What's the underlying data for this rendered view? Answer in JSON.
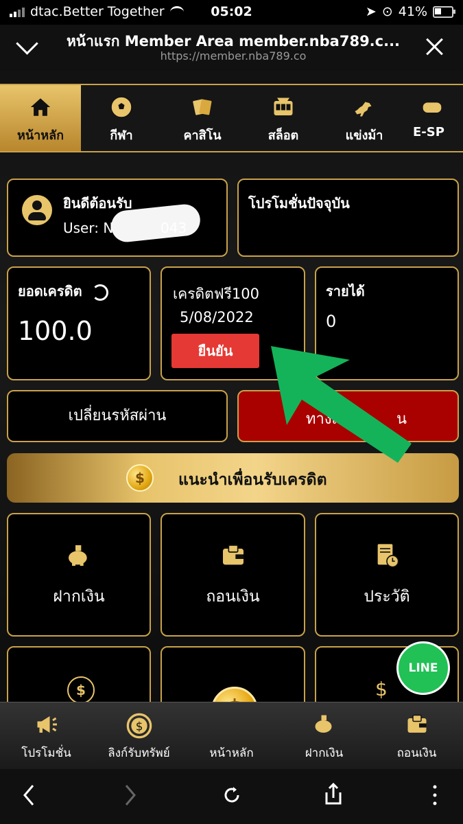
{
  "status_bar": {
    "carrier": "dtac.Better Together",
    "time": "05:02",
    "battery_percent": "41%"
  },
  "browser": {
    "title": "หน้าแรก Member Area member.nba789.c...",
    "url": "https://member.nba789.co"
  },
  "top_nav": {
    "items": [
      {
        "label": "หน้าหลัก",
        "icon": "home-icon",
        "active": true
      },
      {
        "label": "กีฬา",
        "icon": "soccer-ball-icon"
      },
      {
        "label": "คาสิโน",
        "icon": "cards-icon"
      },
      {
        "label": "สล็อต",
        "icon": "slot-machine-icon"
      },
      {
        "label": "แข่งม้า",
        "icon": "horse-racing-icon"
      },
      {
        "label": "E-SP",
        "icon": "gamepad-icon"
      }
    ]
  },
  "welcome": {
    "title": "ยินดีต้อนรับ",
    "user_prefix": "User: N",
    "user_suffix": "043"
  },
  "promo": {
    "title": "โปรโมชั่นปัจจุบัน"
  },
  "credit": {
    "title": "ยอดเครดิต",
    "value": "100.0"
  },
  "free_credit": {
    "title": "เครดิตฟรี100",
    "date": "5/08/2022",
    "confirm_label": "ยืนยัน"
  },
  "income": {
    "title": "รายได้",
    "value": "0"
  },
  "buttons": {
    "change_password": "เปลี่ยนรหัสผ่าน",
    "play_visible_left": "ทางเข",
    "play_visible_right": "น"
  },
  "referral": {
    "label": "แนะนำเพื่อนรับเครดิต"
  },
  "tiles": [
    {
      "label": "ฝากเงิน",
      "icon": "piggy-bank-icon"
    },
    {
      "label": "ถอนเงิน",
      "icon": "wallet-icon"
    },
    {
      "label": "ประวัติ",
      "icon": "history-document-icon"
    }
  ],
  "line_button": {
    "label": "LINE"
  },
  "bottom_nav": {
    "items": [
      {
        "label": "โปรโมชั่น",
        "icon": "megaphone-icon"
      },
      {
        "label": "ลิงก์รับทรัพย์",
        "icon": "dollar-coin-icon"
      },
      {
        "label": "หน้าหลัก",
        "icon": "gold-coin-icon"
      },
      {
        "label": "ฝากเงิน",
        "icon": "piggy-bank-icon"
      },
      {
        "label": "ถอนเงิน",
        "icon": "wallet-icon"
      }
    ]
  },
  "colors": {
    "gold": "#c9a24b",
    "red_confirm": "#e53935",
    "red_button": "#a90000",
    "green_arrow": "#14b35a",
    "line_green": "#21c155"
  }
}
